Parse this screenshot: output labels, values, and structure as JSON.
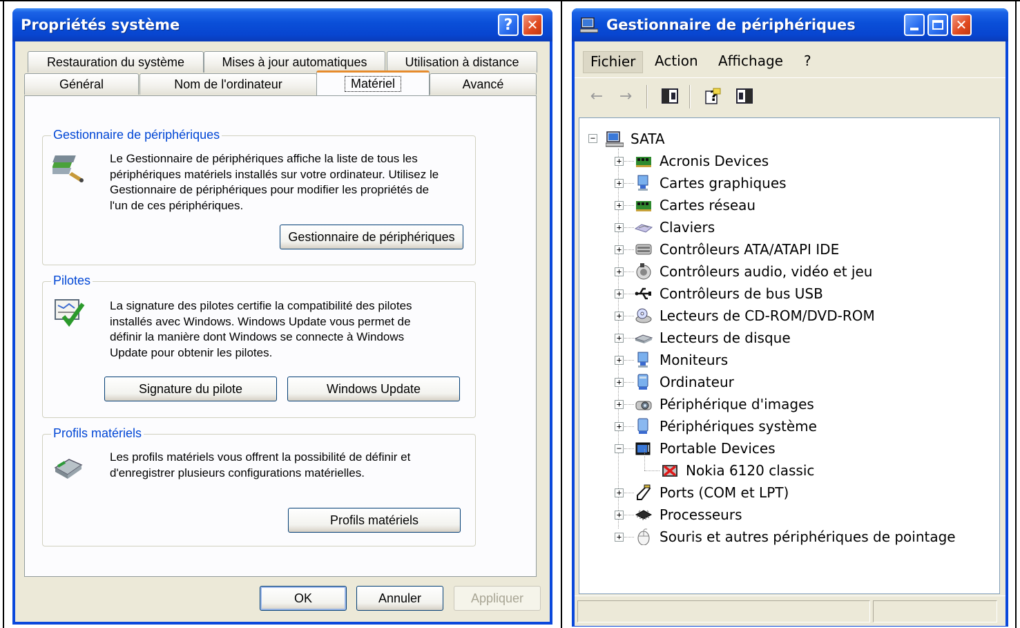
{
  "left_dialog": {
    "title": "Propriétés système",
    "title_buttons": [
      "?",
      "✕"
    ],
    "tabs_row1": [
      "Restauration du système",
      "Mises à jour automatiques",
      "Utilisation à distance"
    ],
    "tabs_row2": [
      "Général",
      "Nom de l'ordinateur",
      "Matériel",
      "Avancé"
    ],
    "active_tab": "Matériel",
    "groups": {
      "device_manager": {
        "title": "Gestionnaire de périphériques",
        "text": [
          "Le Gestionnaire de périphériques affiche la liste de tous les",
          "périphériques matériels installés sur votre ordinateur. Utilisez le",
          "Gestionnaire de périphériques pour modifier les propriétés de",
          "l'un de ces périphériques."
        ],
        "button": "Gestionnaire de périphériques"
      },
      "drivers": {
        "title": "Pilotes",
        "text": [
          "La signature des pilotes certifie la compatibilité des pilotes",
          "installés avec Windows. Windows Update vous permet de",
          "définir la manière dont Windows se connecte à Windows",
          "Update pour obtenir les pilotes."
        ],
        "button_signing": "Signature du pilote",
        "button_update": "Windows Update"
      },
      "profiles": {
        "title": "Profils matériels",
        "text": [
          "Les profils matériels vous offrent la possibilité de définir et",
          "d'enregistrer plusieurs configurations matérielles."
        ],
        "button": "Profils matériels"
      }
    },
    "buttons": {
      "ok": "OK",
      "cancel": "Annuler",
      "apply": "Appliquer"
    }
  },
  "right_window": {
    "title": "Gestionnaire de périphériques",
    "menus": [
      "Fichier",
      "Action",
      "Affichage",
      "?"
    ],
    "toolbar_icons": [
      "back-arrow-icon",
      "forward-arrow-icon",
      "show-hide-tree-icon",
      "help-icon",
      "properties-view-icon"
    ],
    "tree_root": "SATA",
    "tree_items": [
      {
        "label": "Acronis Devices",
        "icon": "network-card-icon",
        "expanded": false
      },
      {
        "label": "Cartes graphiques",
        "icon": "monitor-icon",
        "expanded": false
      },
      {
        "label": "Cartes réseau",
        "icon": "network-card-icon",
        "expanded": false
      },
      {
        "label": "Claviers",
        "icon": "keyboard-icon",
        "expanded": false
      },
      {
        "label": "Contrôleurs ATA/ATAPI IDE",
        "icon": "ide-controller-icon",
        "expanded": false
      },
      {
        "label": "Contrôleurs audio, vidéo et jeu",
        "icon": "speaker-icon",
        "expanded": false
      },
      {
        "label": "Contrôleurs de bus USB",
        "icon": "usb-icon",
        "expanded": false
      },
      {
        "label": "Lecteurs de CD-ROM/DVD-ROM",
        "icon": "cdrom-icon",
        "expanded": false
      },
      {
        "label": "Lecteurs de disque",
        "icon": "disk-drive-icon",
        "expanded": false
      },
      {
        "label": "Moniteurs",
        "icon": "monitor-icon",
        "expanded": false
      },
      {
        "label": "Ordinateur",
        "icon": "computer-icon",
        "expanded": false
      },
      {
        "label": "Périphérique d'images",
        "icon": "camera-icon",
        "expanded": false
      },
      {
        "label": "Périphériques système",
        "icon": "system-device-icon",
        "expanded": false
      },
      {
        "label": "Portable Devices",
        "icon": "portable-device-icon",
        "expanded": true
      },
      {
        "label": "Nokia 6120 classic",
        "icon": "disabled-device-icon",
        "child": true
      },
      {
        "label": "Ports (COM et LPT)",
        "icon": "port-icon",
        "expanded": false
      },
      {
        "label": "Processeurs",
        "icon": "processor-icon",
        "expanded": false
      },
      {
        "label": "Souris et autres périphériques de pointage",
        "icon": "mouse-icon",
        "expanded": false
      }
    ]
  }
}
